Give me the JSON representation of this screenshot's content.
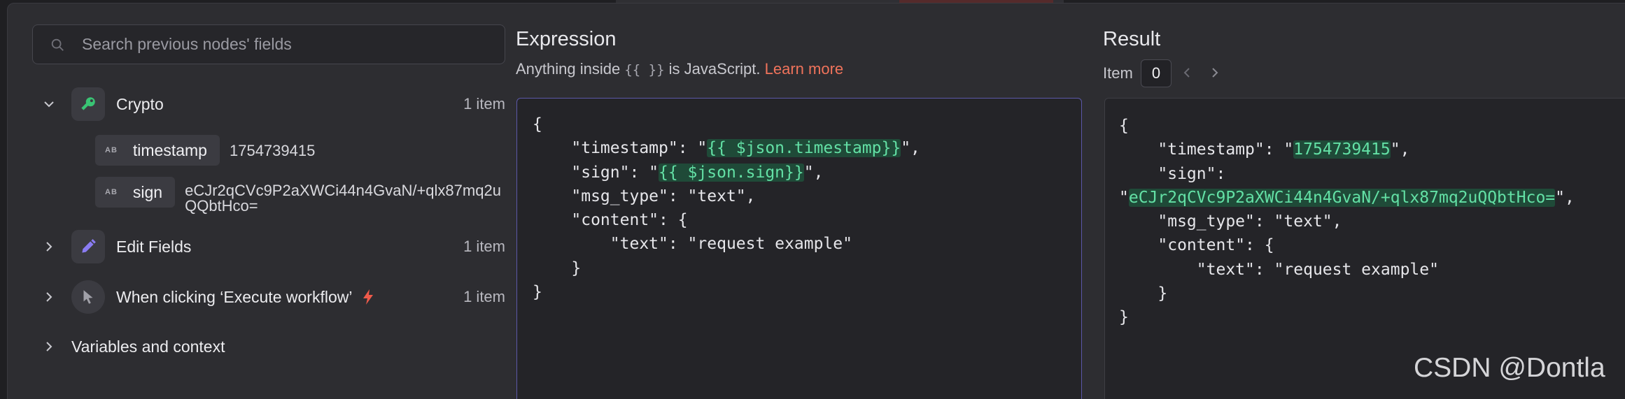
{
  "left": {
    "search_placeholder": "Search previous nodes' fields",
    "nodes": [
      {
        "name": "Crypto",
        "count": "1 item",
        "expanded": true,
        "icon": "key-icon",
        "icon_color": "#39c474"
      },
      {
        "name": "Edit Fields",
        "count": "1 item",
        "expanded": false,
        "icon": "pencil-icon",
        "icon_color": "#8a7cf2"
      },
      {
        "name": "When clicking ‘Execute workflow’",
        "count": "1 item",
        "expanded": false,
        "icon": "cursor-icon",
        "icon_color": "#a0a0a8"
      }
    ],
    "fields": [
      {
        "type": "AB",
        "name": "timestamp",
        "value": "1754739415"
      },
      {
        "type": "AB",
        "name": "sign",
        "value": "eCJr2qCVc9P2aXWCi44n4GvaN/+qlx87mq2uQQbtHco="
      }
    ],
    "variables_label": "Variables and context"
  },
  "expression": {
    "title": "Expression",
    "sub_prefix": "Anything inside",
    "sub_braces": "{{ }}",
    "sub_suffix": "is JavaScript.",
    "learn_more": "Learn more",
    "code": {
      "open": "{",
      "timestamp_key": "    \"timestamp\": \"",
      "timestamp_expr": "{{ $json.timestamp}}",
      "timestamp_end": "\",",
      "sign_key": "    \"sign\": \"",
      "sign_expr": "{{ $json.sign}}",
      "sign_end": "\",",
      "msg_type": "    \"msg_type\": \"text\",",
      "content_open": "    \"content\": {",
      "text": "        \"text\": \"request example\"",
      "content_close": "    }",
      "close": "}"
    }
  },
  "result": {
    "title": "Result",
    "item_label": "Item",
    "item_index": "0",
    "code": {
      "open": "{",
      "timestamp_key": "    \"timestamp\": \"",
      "timestamp_val": "1754739415",
      "timestamp_end": "\",",
      "sign_key": "    \"sign\":",
      "sign_quote": "\"",
      "sign_val": "eCJr2qCVc9P2aXWCi44n4GvaN/+qlx87mq2uQQbtHco=",
      "sign_end": "\",",
      "msg_type": "    \"msg_type\": \"text\",",
      "content_open": "    \"content\": {",
      "text": "        \"text\": \"request example\"",
      "content_close": "    }",
      "close": "}"
    }
  },
  "watermark": "CSDN @Dontla",
  "colors": {
    "accent_link": "#f0735b",
    "highlight_bg": "#1f4a38",
    "highlight_fg": "#63e0a5",
    "editor_border": "#5c58a8",
    "bolt": "#ef5a4a"
  }
}
